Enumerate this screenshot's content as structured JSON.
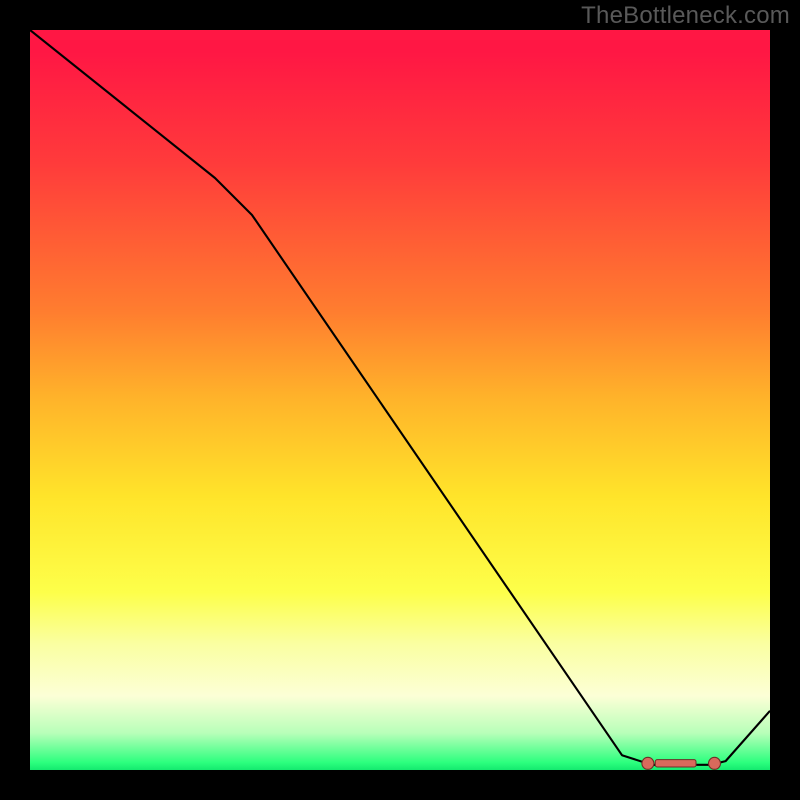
{
  "watermark": "TheBottleneck.com",
  "chart_data": {
    "type": "line",
    "title": "",
    "xlabel": "",
    "ylabel": "",
    "xlim": [
      0,
      100
    ],
    "ylim": [
      0,
      100
    ],
    "path": [
      {
        "x": 0,
        "y": 100
      },
      {
        "x": 25,
        "y": 80
      },
      {
        "x": 30,
        "y": 75
      },
      {
        "x": 80,
        "y": 2
      },
      {
        "x": 84,
        "y": 0.7
      },
      {
        "x": 92,
        "y": 0.7
      },
      {
        "x": 94,
        "y": 1.2
      },
      {
        "x": 100,
        "y": 8
      }
    ],
    "markers": [
      {
        "x": 83.5,
        "y": 0.9
      },
      {
        "x": 92.5,
        "y": 0.9
      }
    ],
    "bar": {
      "x0": 84.5,
      "x1": 90.0,
      "y": 0.9,
      "h": 1.0
    }
  },
  "colors": {
    "line": "#000000",
    "marker_fill": "#d86a5c",
    "marker_stroke": "#6e2f27"
  }
}
